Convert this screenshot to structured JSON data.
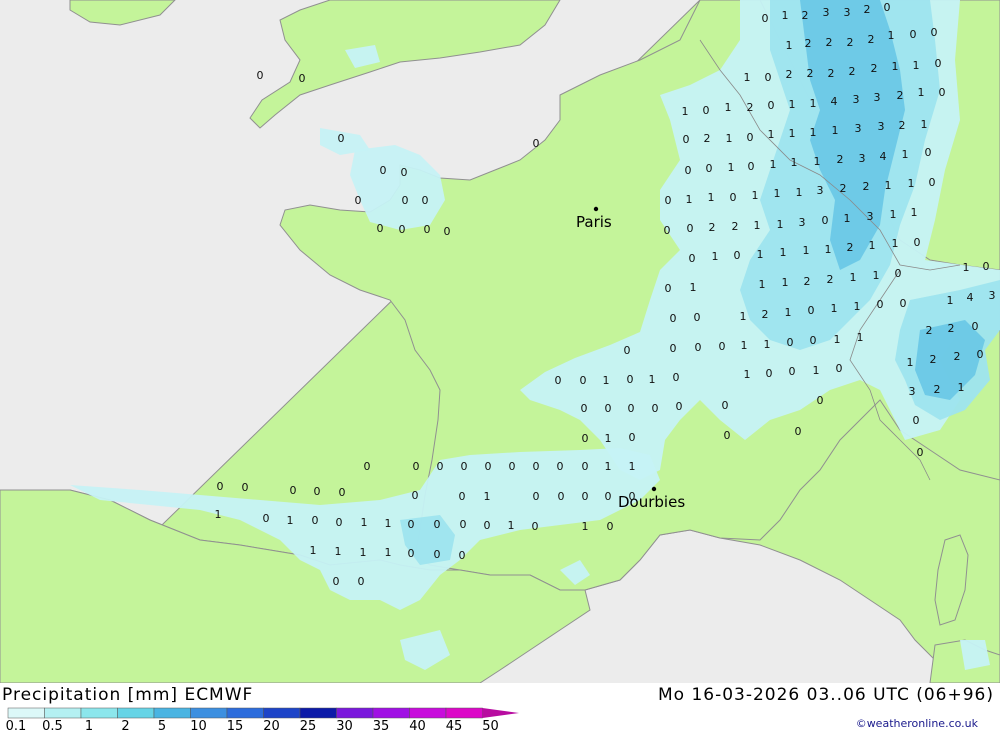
{
  "title_left": "Precipitation [mm] ECMWF",
  "title_right": "Mo 16-03-2026 03..06 UTC (06+96)",
  "credit": "©weatheronline.co.uk",
  "colors": {
    "sea": "#ececec",
    "land": "#c4f49a",
    "coast": "#909090",
    "precip_light": "#c6f2f5",
    "precip_mid": "#9ee4ee",
    "precip_heavy": "#6cc8e6"
  },
  "cities": [
    {
      "name": "Paris"
    },
    {
      "name": "Dourbies"
    }
  ],
  "legend": {
    "labels": [
      "0.1",
      "0.5",
      "1",
      "2",
      "5",
      "10",
      "15",
      "20",
      "25",
      "30",
      "35",
      "40",
      "45",
      "50"
    ],
    "colors": [
      "#dcf8f8",
      "#b4f0f2",
      "#8ce6ec",
      "#66d4e6",
      "#4ab4e2",
      "#3c8fe0",
      "#2c6cdc",
      "#1d44c8",
      "#0c1aa8",
      "#7a18dc",
      "#a010e4",
      "#c80cdc",
      "#dc08c8",
      "#b80ca0"
    ]
  },
  "precip_values": [
    {
      "v": "0"
    },
    {
      "v": "1"
    },
    {
      "v": "2"
    },
    {
      "v": "3"
    },
    {
      "v": "3"
    },
    {
      "v": "2"
    },
    {
      "v": "0"
    },
    {
      "v": "1"
    },
    {
      "v": "2"
    },
    {
      "v": "2"
    },
    {
      "v": "2"
    },
    {
      "v": "2"
    },
    {
      "v": "1"
    },
    {
      "v": "0"
    },
    {
      "v": "0"
    },
    {
      "v": "1"
    },
    {
      "v": "0"
    },
    {
      "v": "2"
    },
    {
      "v": "2"
    },
    {
      "v": "2"
    },
    {
      "v": "2"
    },
    {
      "v": "2"
    },
    {
      "v": "1"
    },
    {
      "v": "1"
    },
    {
      "v": "0"
    },
    {
      "v": "1"
    },
    {
      "v": "0"
    },
    {
      "v": "1"
    },
    {
      "v": "2"
    },
    {
      "v": "0"
    },
    {
      "v": "1"
    },
    {
      "v": "1"
    },
    {
      "v": "4"
    },
    {
      "v": "3"
    },
    {
      "v": "3"
    },
    {
      "v": "2"
    },
    {
      "v": "1"
    },
    {
      "v": "0"
    },
    {
      "v": "0"
    },
    {
      "v": "2"
    },
    {
      "v": "1"
    },
    {
      "v": "0"
    },
    {
      "v": "1"
    },
    {
      "v": "1"
    },
    {
      "v": "1"
    },
    {
      "v": "1"
    },
    {
      "v": "3"
    },
    {
      "v": "3"
    },
    {
      "v": "2"
    },
    {
      "v": "1"
    },
    {
      "v": "0"
    },
    {
      "v": "0"
    },
    {
      "v": "1"
    },
    {
      "v": "0"
    },
    {
      "v": "1"
    },
    {
      "v": "1"
    },
    {
      "v": "1"
    },
    {
      "v": "2"
    },
    {
      "v": "3"
    },
    {
      "v": "4"
    },
    {
      "v": "1"
    },
    {
      "v": "0"
    },
    {
      "v": "0"
    },
    {
      "v": "1"
    },
    {
      "v": "1"
    },
    {
      "v": "0"
    },
    {
      "v": "1"
    },
    {
      "v": "1"
    },
    {
      "v": "1"
    },
    {
      "v": "3"
    },
    {
      "v": "2"
    },
    {
      "v": "2"
    },
    {
      "v": "1"
    },
    {
      "v": "1"
    },
    {
      "v": "0"
    },
    {
      "v": "0"
    },
    {
      "v": "0"
    },
    {
      "v": "2"
    },
    {
      "v": "2"
    },
    {
      "v": "1"
    },
    {
      "v": "1"
    },
    {
      "v": "3"
    },
    {
      "v": "0"
    },
    {
      "v": "1"
    },
    {
      "v": "3"
    },
    {
      "v": "1"
    },
    {
      "v": "1"
    },
    {
      "v": "0"
    },
    {
      "v": "1"
    },
    {
      "v": "0"
    },
    {
      "v": "1"
    },
    {
      "v": "1"
    },
    {
      "v": "1"
    },
    {
      "v": "1"
    },
    {
      "v": "2"
    },
    {
      "v": "1"
    },
    {
      "v": "1"
    },
    {
      "v": "0"
    },
    {
      "v": "0"
    },
    {
      "v": "1"
    },
    {
      "v": "1"
    },
    {
      "v": "1"
    },
    {
      "v": "2"
    },
    {
      "v": "2"
    },
    {
      "v": "1"
    },
    {
      "v": "1"
    },
    {
      "v": "0"
    },
    {
      "v": "1"
    },
    {
      "v": "0"
    },
    {
      "v": "1"
    },
    {
      "v": "4"
    },
    {
      "v": "3"
    },
    {
      "v": "0"
    },
    {
      "v": "0"
    },
    {
      "v": "1"
    },
    {
      "v": "2"
    },
    {
      "v": "1"
    },
    {
      "v": "0"
    },
    {
      "v": "1"
    },
    {
      "v": "1"
    },
    {
      "v": "0"
    },
    {
      "v": "0"
    },
    {
      "v": "2"
    },
    {
      "v": "2"
    },
    {
      "v": "0"
    },
    {
      "v": "0"
    },
    {
      "v": "0"
    },
    {
      "v": "0"
    },
    {
      "v": "0"
    },
    {
      "v": "1"
    },
    {
      "v": "1"
    },
    {
      "v": "0"
    },
    {
      "v": "0"
    },
    {
      "v": "1"
    },
    {
      "v": "1"
    },
    {
      "v": "1"
    },
    {
      "v": "2"
    },
    {
      "v": "2"
    },
    {
      "v": "0"
    },
    {
      "v": "0"
    },
    {
      "v": "0"
    },
    {
      "v": "1"
    },
    {
      "v": "0"
    },
    {
      "v": "1"
    },
    {
      "v": "0"
    },
    {
      "v": "1"
    },
    {
      "v": "0"
    },
    {
      "v": "0"
    },
    {
      "v": "1"
    },
    {
      "v": "0"
    },
    {
      "v": "3"
    },
    {
      "v": "2"
    },
    {
      "v": "1"
    },
    {
      "v": "0"
    },
    {
      "v": "0"
    },
    {
      "v": "0"
    },
    {
      "v": "0"
    },
    {
      "v": "0"
    },
    {
      "v": "0"
    },
    {
      "v": "0"
    },
    {
      "v": "0"
    },
    {
      "v": "0"
    },
    {
      "v": "1"
    },
    {
      "v": "0"
    },
    {
      "v": "0"
    },
    {
      "v": "0"
    },
    {
      "v": "0"
    },
    {
      "v": "0"
    },
    {
      "v": "0"
    },
    {
      "v": "0"
    },
    {
      "v": "0"
    },
    {
      "v": "0"
    },
    {
      "v": "0"
    },
    {
      "v": "0"
    },
    {
      "v": "0"
    },
    {
      "v": "0"
    },
    {
      "v": "1"
    },
    {
      "v": "1"
    },
    {
      "v": "0"
    },
    {
      "v": "0"
    },
    {
      "v": "0"
    },
    {
      "v": "0"
    },
    {
      "v": "0"
    },
    {
      "v": "0"
    },
    {
      "v": "0"
    },
    {
      "v": "1"
    },
    {
      "v": "0"
    },
    {
      "v": "0"
    },
    {
      "v": "0"
    },
    {
      "v": "0"
    },
    {
      "v": "0"
    },
    {
      "v": "1"
    },
    {
      "v": "0"
    },
    {
      "v": "1"
    },
    {
      "v": "0"
    },
    {
      "v": "0"
    },
    {
      "v": "1"
    },
    {
      "v": "1"
    },
    {
      "v": "0"
    },
    {
      "v": "0"
    },
    {
      "v": "0"
    },
    {
      "v": "0"
    },
    {
      "v": "1"
    },
    {
      "v": "0"
    },
    {
      "v": "1"
    },
    {
      "v": "0"
    },
    {
      "v": "1"
    },
    {
      "v": "1"
    },
    {
      "v": "1"
    },
    {
      "v": "1"
    },
    {
      "v": "0"
    },
    {
      "v": "0"
    },
    {
      "v": "0"
    },
    {
      "v": "0"
    },
    {
      "v": "0"
    },
    {
      "v": "0"
    },
    {
      "v": "0"
    },
    {
      "v": "0"
    },
    {
      "v": "0"
    },
    {
      "v": "0"
    },
    {
      "v": "0"
    },
    {
      "v": "0"
    },
    {
      "v": "0"
    },
    {
      "v": "0"
    },
    {
      "v": "0"
    },
    {
      "v": "0"
    },
    {
      "v": "0"
    },
    {
      "v": "0"
    }
  ]
}
